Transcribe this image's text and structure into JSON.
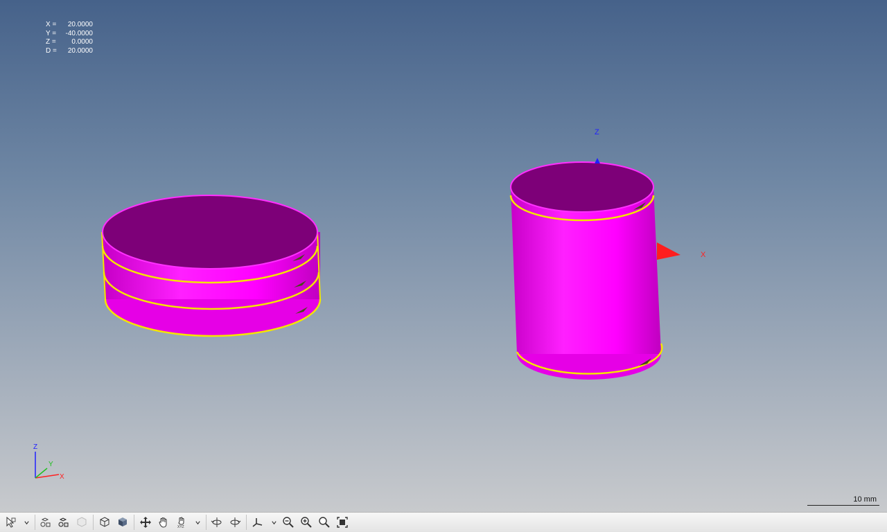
{
  "readout": {
    "x_label": "X =",
    "x_value": "20.0000",
    "y_label": "Y =",
    "y_value": "-40.0000",
    "z_label": "Z =",
    "z_value": "0.0000",
    "d_label": "D =",
    "d_value": "20.0000"
  },
  "model_axes": {
    "z": "Z",
    "x": "X"
  },
  "triad": {
    "z": "Z",
    "y": "Y",
    "x": "X"
  },
  "scale": {
    "label": "10 mm"
  },
  "colors": {
    "part_top": "#7d0078",
    "part_side": "#ff00ff",
    "edge_loop": "#f5e400",
    "arrow": "#4a4a1a",
    "x_axis": "#ff2020",
    "y_axis": "#20c020",
    "z_axis": "#2020ff"
  },
  "toolbar": {
    "buttons": [
      "select-icon",
      "dropdown",
      "hide-icon",
      "show-icon",
      "isolate-icon",
      "wireframe-icon",
      "shaded-icon",
      "pan-icon",
      "hand-icon",
      "rotate-xyz-icon",
      "dropdown",
      "rotate-left-icon",
      "rotate-right-icon",
      "axes-icon",
      "dropdown",
      "zoom-out-icon",
      "zoom-in-icon",
      "zoom-window-icon",
      "fit-icon"
    ]
  }
}
